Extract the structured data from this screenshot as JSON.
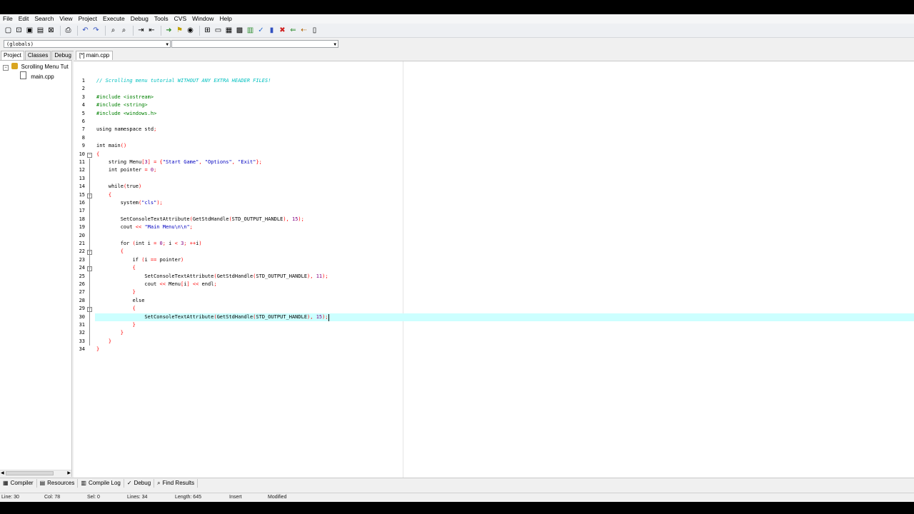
{
  "menu": [
    "File",
    "Edit",
    "Search",
    "View",
    "Project",
    "Execute",
    "Debug",
    "Tools",
    "CVS",
    "Window",
    "Help"
  ],
  "toolbar_icons": [
    "new-file-icon",
    "open-icon",
    "save-icon",
    "save-all-icon",
    "close-icon",
    "print-icon",
    "undo-icon",
    "redo-icon",
    "find-icon",
    "replace-icon",
    "indent-icon",
    "unindent-icon",
    "goto-icon",
    "bookmark-icon",
    "toggle-icon",
    "new-project-icon",
    "project-options-icon",
    "class-browser-icon",
    "compile-icon",
    "run-icon",
    "compile-run-icon",
    "rebuild-icon",
    "stop-icon",
    "debug-icon",
    "add-watch-icon",
    "step-icon"
  ],
  "combos": {
    "left_value": "(globals)",
    "right_value": ""
  },
  "left_tabs": [
    "Project",
    "Classes",
    "Debug"
  ],
  "tree": {
    "project": "Scrolling Menu Tut",
    "file": "main.cpp"
  },
  "editor_tab": "[*] main.cpp",
  "lines": [
    "// Scrolling menu tutorial WITHOUT ANY EXTRA HEADER FILES!",
    "",
    "#include <iostream>",
    "#include <string>",
    "#include <windows.h>",
    "",
    "using namespace std;",
    "",
    "int main()",
    "{",
    "    string Menu[3] = {\"Start Game\", \"Options\", \"Exit\"};",
    "    int pointer = 0;",
    "",
    "    while(true)",
    "    {",
    "        system(\"cls\");",
    "",
    "        SetConsoleTextAttribute(GetStdHandle(STD_OUTPUT_HANDLE), 15);",
    "        cout << \"Main Menu\\n\\n\";",
    "",
    "        for (int i = 0; i < 3; ++i)",
    "        {",
    "            if (i == pointer)",
    "            {",
    "                SetConsoleTextAttribute(GetStdHandle(STD_OUTPUT_HANDLE), 11);",
    "                cout << Menu[i] << endl;",
    "            }",
    "            else",
    "            {",
    "                SetConsoleTextAttribute(GetStdHandle(STD_OUTPUT_HANDLE), 15);",
    "            }",
    "        }",
    "    }",
    "}"
  ],
  "current_line": 30,
  "bottom_tabs": [
    {
      "label": "Compiler",
      "icon": "compiler-icon"
    },
    {
      "label": "Resources",
      "icon": "resources-icon"
    },
    {
      "label": "Compile Log",
      "icon": "compile-log-icon"
    },
    {
      "label": "Debug",
      "icon": "debug-icon"
    },
    {
      "label": "Find Results",
      "icon": "find-results-icon"
    }
  ],
  "status": {
    "line": "Line:    30",
    "col": "Col:    78",
    "sel": "Sel:    0",
    "lines": "Lines:    34",
    "length": "Length:   645",
    "mode": "Insert",
    "modified": "Modified"
  },
  "colors": {
    "highlight": "#ccffff",
    "comment": "#00c0c0",
    "preprocessor": "#008000",
    "string": "#0000c0",
    "symbol": "#ff0000",
    "number": "#800080"
  }
}
